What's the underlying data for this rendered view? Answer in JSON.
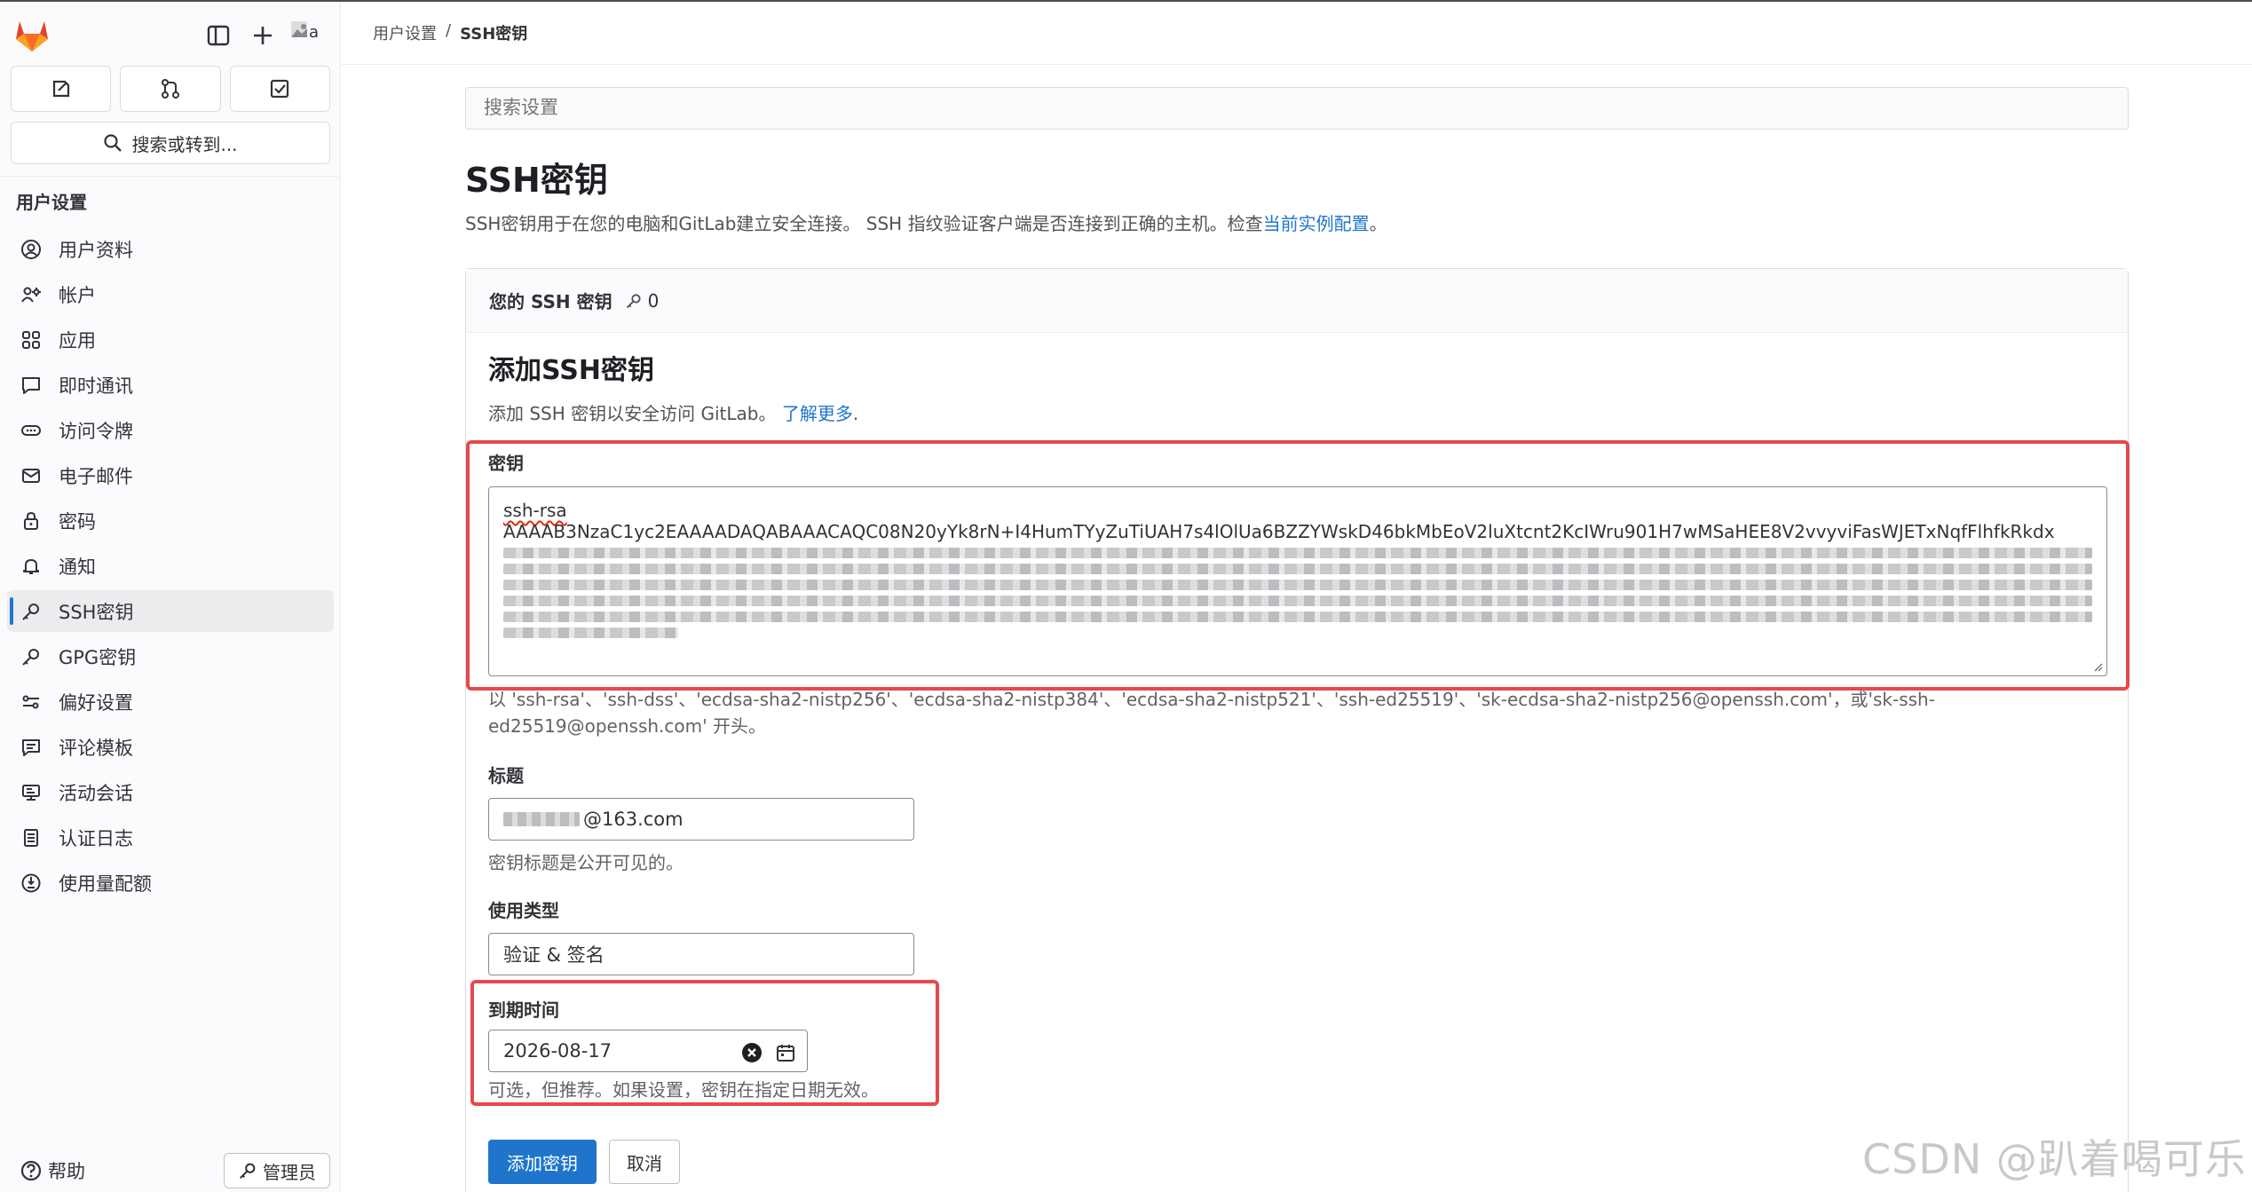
{
  "breadcrumb": {
    "parent": "用户设置",
    "separator": "/",
    "current": "SSH密钥"
  },
  "sidebar": {
    "search_label": "搜索或转到...",
    "section_title": "用户设置",
    "items": [
      {
        "label": "用户资料",
        "icon": "profile-icon"
      },
      {
        "label": "帐户",
        "icon": "account-icon"
      },
      {
        "label": "应用",
        "icon": "applications-icon"
      },
      {
        "label": "即时通讯",
        "icon": "chat-icon"
      },
      {
        "label": "访问令牌",
        "icon": "token-icon"
      },
      {
        "label": "电子邮件",
        "icon": "mail-icon"
      },
      {
        "label": "密码",
        "icon": "lock-icon"
      },
      {
        "label": "通知",
        "icon": "bell-icon"
      },
      {
        "label": "SSH密钥",
        "icon": "key-icon",
        "active": true
      },
      {
        "label": "GPG密钥",
        "icon": "key-icon"
      },
      {
        "label": "偏好设置",
        "icon": "preferences-icon"
      },
      {
        "label": "评论模板",
        "icon": "comment-template-icon"
      },
      {
        "label": "活动会话",
        "icon": "monitor-icon"
      },
      {
        "label": "认证日志",
        "icon": "log-icon"
      },
      {
        "label": "使用量配额",
        "icon": "quota-icon"
      }
    ],
    "help_label": "帮助",
    "admin_label": "管理员",
    "avatar_alt": "a"
  },
  "main": {
    "search_placeholder": "搜索设置",
    "page_title": "SSH密钥",
    "page_desc_prefix": "SSH密钥用于在您的电脑和GitLab建立安全连接。 SSH 指纹验证客户端是否连接到正确的主机。检查",
    "page_desc_link": "当前实例配置",
    "page_desc_suffix": "。",
    "card_header": "您的 SSH 密钥",
    "key_count": "0",
    "add_title": "添加SSH密钥",
    "add_desc_prefix": "添加 SSH 密钥以安全访问 GitLab。",
    "add_desc_link": "了解更多",
    "add_desc_suffix": ".",
    "key_label": "密钥",
    "key_line1": "ssh-rsa",
    "key_line2": "AAAAB3NzaC1yc2EAAAADAQABAAACAQC08N20yYk8rN+I4HumTYyZuTiUAH7s4lOlUa6BZZYWskD46bkMbEoV2luXtcnt2KcIWru901H7wMSaHEE8V2vvyviFasWJETxNqfFlhfkRkdx",
    "key_help_line1": "以 'ssh-rsa'、'ssh-dss'、'ecdsa-sha2-nistp256'、'ecdsa-sha2-nistp384'、'ecdsa-sha2-nistp521'、'ssh-ed25519'、'sk-ecdsa-sha2-nistp256@openssh.com'，或'sk-ssh-",
    "key_help_line2": "ed25519@openssh.com' 开头。",
    "title_label": "标题",
    "title_value": "@163.com",
    "title_help": "密钥标题是公开可见的。",
    "usage_label": "使用类型",
    "usage_value": "验证 & 签名",
    "expiry_label": "到期时间",
    "expiry_value": "2026-08-17",
    "expiry_help": "可选，但推荐。如果设置，密钥在指定日期无效。",
    "add_button": "添加密钥",
    "cancel_button": "取消"
  },
  "watermark": "CSDN @趴着喝可乐",
  "colors": {
    "accent": "#1f75cb",
    "highlight": "#e5484d",
    "logo": "#e24329"
  }
}
